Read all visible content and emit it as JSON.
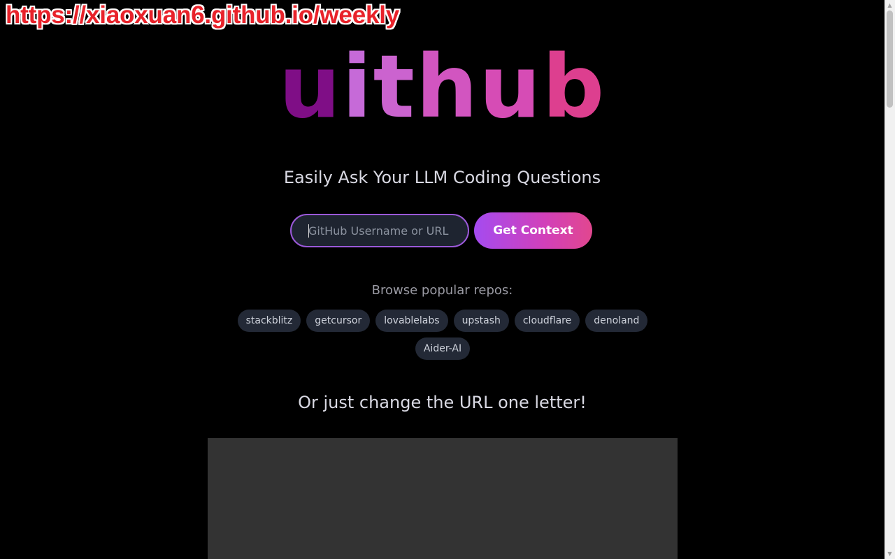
{
  "watermark": "https://xiaoxuan6.github.io/weekly",
  "logo": {
    "letters": [
      "u",
      "i",
      "t",
      "h",
      "u",
      "b"
    ],
    "colors": [
      "#7f0e86",
      "#c66ad8",
      "#cb63cf",
      "#d255c0",
      "#d64cb5",
      "#dd3f8f"
    ]
  },
  "tagline": "Easily Ask Your LLM Coding Questions",
  "search": {
    "placeholder": "GitHub Username or URL",
    "value": ""
  },
  "button": {
    "label": "Get Context"
  },
  "browse": {
    "label": "Browse popular repos:",
    "repos": [
      "stackblitz",
      "getcursor",
      "lovablelabs",
      "upstash",
      "cloudflare",
      "denoland",
      "Aider-AI"
    ]
  },
  "subheading": "Or just change the URL one letter!"
}
